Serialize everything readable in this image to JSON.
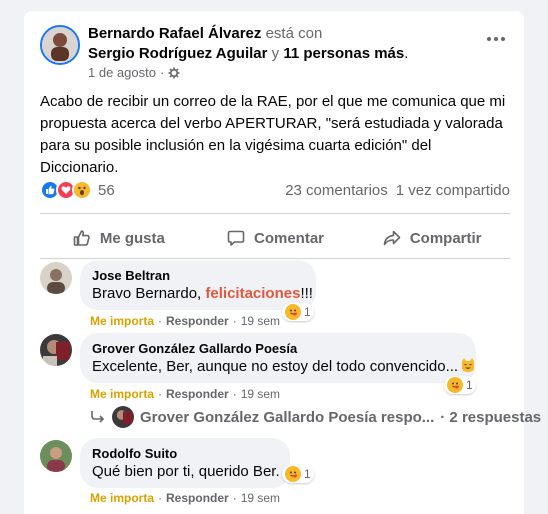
{
  "post": {
    "author": "Bernardo Rafael Álvarez",
    "with_text": "está con",
    "tagged_person": "Sergio Rodríguez Aguilar",
    "and_text": "y",
    "others": "11 personas más",
    "period": ".",
    "date": "1 de agosto",
    "separator": "·",
    "privacy_icon": "gear-icon",
    "body": "Acabo de recibir un correo de la RAE, por el que me comunica que mi propuesta acerca del verbo APERTURAR, \"será estudiada y valorada para su posible inclusión en la vigésima cuarta edición\" del Diccionario.",
    "reaction_count": "56",
    "comments_count": "23 comentarios",
    "shares_count": "1 vez compartido"
  },
  "actions": {
    "like": "Me gusta",
    "comment": "Comentar",
    "share": "Compartir"
  },
  "comments": [
    {
      "name": "Jose Beltran",
      "text_before": "Bravo Bernardo, ",
      "text_highlight": "felicitaciones",
      "text_after": "!!!",
      "reaction_label": "Me importa",
      "reply_label": "Responder",
      "time": "19 sem",
      "reaction_count": "1"
    },
    {
      "name": "Grover González Gallardo Poesía",
      "text": "Excelente, Ber, aunque no estoy del todo convencido...",
      "reaction_label": "Me importa",
      "reply_label": "Responder",
      "time": "19 sem",
      "reaction_count": "1",
      "replies_author_text": "Grover González Gallardo Poesía respo...",
      "replies_count": "· 2 respuestas"
    },
    {
      "name": "Rodolfo Suito",
      "text": "Qué bien por ti, querido Ber.",
      "reaction_label": "Me importa",
      "reply_label": "Responder",
      "time": "19 sem",
      "reaction_count": "1"
    }
  ],
  "dot": "·",
  "colors": {
    "accent_blue": "#1877f2",
    "highlight": "#e4573d",
    "care_yellow": "#f7b928"
  }
}
